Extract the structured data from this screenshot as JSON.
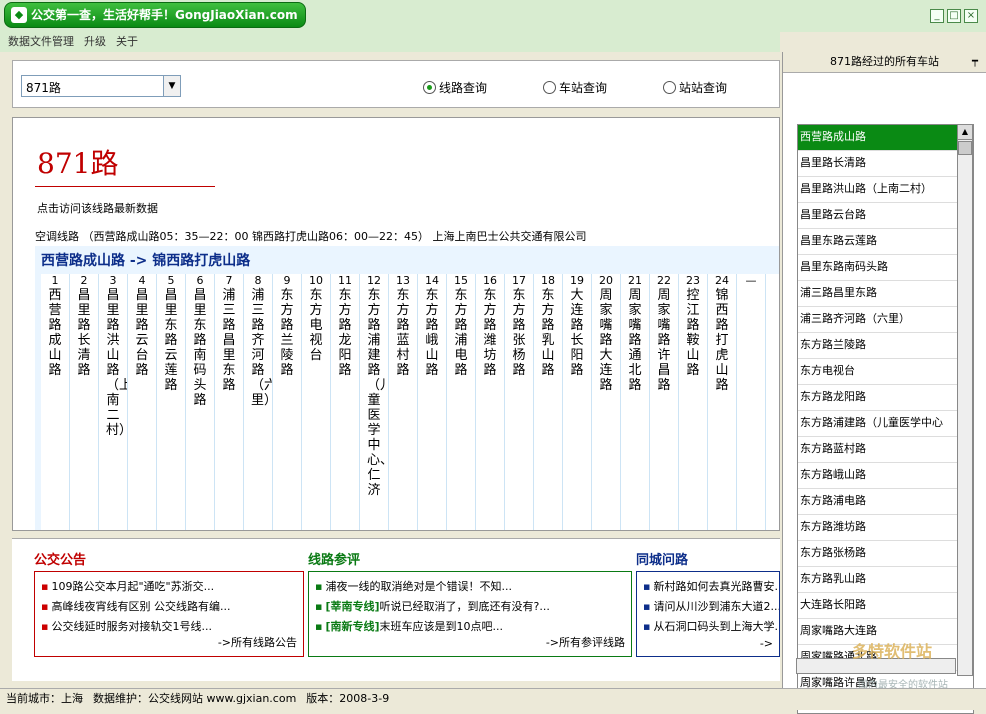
{
  "window": {
    "title": "公交第一查，生活好帮手！GongJiaoXian.com",
    "buttons": [
      "_",
      "□",
      "×"
    ]
  },
  "menu": [
    "数据文件管理",
    "升级",
    "关于"
  ],
  "search": {
    "route_value": "871路",
    "options": [
      {
        "label": "线路查询",
        "selected": true
      },
      {
        "label": "车站查询",
        "selected": false
      },
      {
        "label": "站站查询",
        "selected": false
      }
    ]
  },
  "route": {
    "name": "871路",
    "visit_link": "点击访问该线路最新数据",
    "info": "空调线路 （西营路成山路05：35—22：00  锦西路打虎山路06：00—22：45）  上海上南巴士公共交通有限公司",
    "direction": "西营路成山路  ->  锦西路打虎山路",
    "stops": [
      {
        "num": "1",
        "name": "西营路成山路"
      },
      {
        "num": "2",
        "name": "昌里路长清路"
      },
      {
        "num": "3",
        "name": "昌里路洪山路（上南二村）"
      },
      {
        "num": "4",
        "name": "昌里路云台路"
      },
      {
        "num": "5",
        "name": "昌里东路云莲路"
      },
      {
        "num": "6",
        "name": "昌里东路南码头路"
      },
      {
        "num": "7",
        "name": "浦三路昌里东路"
      },
      {
        "num": "8",
        "name": "浦三路齐河路（六里）"
      },
      {
        "num": "9",
        "name": "东方路兰陵路"
      },
      {
        "num": "10",
        "name": "东方电视台"
      },
      {
        "num": "11",
        "name": "东方路龙阳路"
      },
      {
        "num": "12",
        "name": "东方路浦建路（儿童医学中心、仁济"
      },
      {
        "num": "13",
        "name": "东方路蓝村路"
      },
      {
        "num": "14",
        "name": "东方路峨山路"
      },
      {
        "num": "15",
        "name": "东方路浦电路"
      },
      {
        "num": "16",
        "name": "东方路潍坊路"
      },
      {
        "num": "17",
        "name": "东方路张杨路"
      },
      {
        "num": "18",
        "name": "东方路乳山路"
      },
      {
        "num": "19",
        "name": "大连路长阳路"
      },
      {
        "num": "20",
        "name": "周家嘴路大连路"
      },
      {
        "num": "21",
        "name": "周家嘴路通北路"
      },
      {
        "num": "22",
        "name": "周家嘴路许昌路"
      },
      {
        "num": "23",
        "name": "控江路鞍山路"
      },
      {
        "num": "24",
        "name": "锦西路打虎山路"
      },
      {
        "num": "—",
        "name": ""
      },
      {
        "num": "·",
        "name": ""
      }
    ]
  },
  "sections": [
    {
      "title": "公交公告",
      "color": "#c00000",
      "items": [
        "109路公交本月起\"通吃\"苏浙交...",
        "高峰线夜宵线有区别 公交线路有编...",
        "公交线延时服务对接轨交1号线..."
      ],
      "more": "->所有线路公告"
    },
    {
      "title": "线路参评",
      "color": "#0a7a14",
      "items": [
        {
          "tag": "",
          "text": "浦夜一线的取消绝对是个错误！不知..."
        },
        {
          "tag": "[莘南专线]",
          "text": "听说已经取消了，到底还有没有?..."
        },
        {
          "tag": "[南新专线]",
          "text": "末班车应该是到10点吧..."
        }
      ],
      "more": "->所有参评线路"
    },
    {
      "title": "同城问路",
      "color": "#0d2e8a",
      "items": [
        "新村路如何去真光路曹安...",
        "请问从川沙到浦东大道2...",
        "从石洞口码头到上海大学..."
      ],
      "more": "->"
    }
  ],
  "sidepanel": {
    "header": "871路经过的所有车站",
    "stations": [
      "西营路成山路",
      "昌里路长清路",
      "昌里路洪山路（上南二村）",
      "昌里路云台路",
      "昌里东路云莲路",
      "昌里东路南码头路",
      "浦三路昌里东路",
      "浦三路齐河路（六里）",
      "东方路兰陵路",
      "东方电视台",
      "东方路龙阳路",
      "东方路浦建路（儿童医学中心",
      "东方路蓝村路",
      "东方路峨山路",
      "东方路浦电路",
      "东方路潍坊路",
      "东方路张杨路",
      "东方路乳山路",
      "大连路长阳路",
      "周家嘴路大连路",
      "周家嘴路通北路",
      "周家嘴路许昌路"
    ]
  },
  "status": {
    "city": "当前城市：上海",
    "maintainer": "数据维护：公交线网站 www.gjxian.com",
    "version": "版本：2008-3-9"
  },
  "watermark": {
    "brand": "多特软件站",
    "tagline": "国内最安全的软件站"
  }
}
